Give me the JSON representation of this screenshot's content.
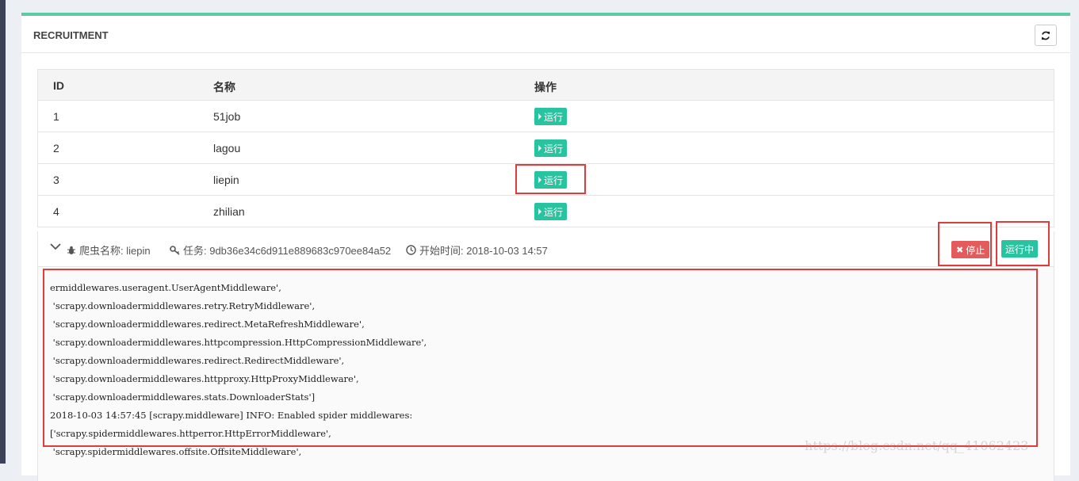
{
  "panel": {
    "title": "RECRUITMENT",
    "accent_color": "#5cc9a7",
    "refresh_icon": "refresh-icon"
  },
  "table": {
    "headers": {
      "id": "ID",
      "name": "名称",
      "op": "操作"
    },
    "rows": [
      {
        "id": "1",
        "name": "51job",
        "action": "运行"
      },
      {
        "id": "2",
        "name": "lagou",
        "action": "运行"
      },
      {
        "id": "3",
        "name": "liepin",
        "action": "运行"
      },
      {
        "id": "4",
        "name": "zhilian",
        "action": "运行"
      }
    ]
  },
  "job": {
    "spider_label": "爬虫名称: liepin",
    "task_label": "任务: 9db36e34c6d911e889683c970ee84a52",
    "start_label": "开始时间: 2018-10-03 14:57",
    "stop_button": "停止",
    "status_button": "运行中"
  },
  "log": {
    "lines": [
      "ermiddlewares.useragent.UserAgentMiddleware',",
      " 'scrapy.downloadermiddlewares.retry.RetryMiddleware',",
      " 'scrapy.downloadermiddlewares.redirect.MetaRefreshMiddleware',",
      " 'scrapy.downloadermiddlewares.httpcompression.HttpCompressionMiddleware',",
      " 'scrapy.downloadermiddlewares.redirect.RedirectMiddleware',",
      " 'scrapy.downloadermiddlewares.httpproxy.HttpProxyMiddleware',",
      " 'scrapy.downloadermiddlewares.stats.DownloaderStats']",
      "2018-10-03 14:57:45 [scrapy.middleware] INFO: Enabled spider middlewares:",
      "['scrapy.spidermiddlewares.httperror.HttpErrorMiddleware',",
      " 'scrapy.spidermiddlewares.offsite.OffsiteMiddleware',"
    ]
  },
  "watermark": "https://blog.csdn.net/qq_41062423"
}
